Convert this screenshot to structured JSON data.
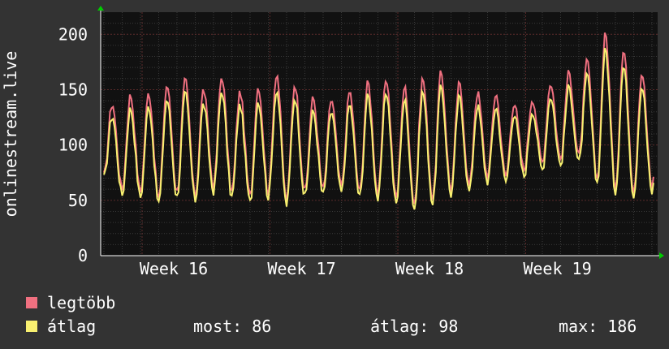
{
  "chart_data": {
    "type": "line",
    "ylabel": "onlinestream.live",
    "ylim": [
      0,
      220
    ],
    "y_ticks": [
      0,
      50,
      100,
      150,
      200
    ],
    "x_ticks": [
      "Week 16",
      "Week 17",
      "Week 18",
      "Week 19"
    ],
    "grid": true,
    "colors": {
      "max": "#f07080",
      "avg": "#f8f070",
      "background": "#333333",
      "plot": "#111111",
      "axis_arrow": "#00cc00"
    },
    "series": [
      {
        "name": "legtöbb",
        "daily_peaks": [
          137,
          145,
          147,
          154,
          158,
          150,
          162,
          148,
          153,
          165,
          155,
          142,
          141,
          148,
          156,
          160,
          152,
          160,
          165,
          155,
          147,
          146,
          138,
          142,
          156,
          165,
          175,
          200,
          185,
          165,
          157,
          163,
          160,
          140,
          142,
          154,
          135
        ],
        "daily_troughs": [
          72,
          60,
          58,
          52,
          58,
          54,
          63,
          58,
          54,
          58,
          50,
          58,
          60,
          62,
          58,
          56,
          52,
          48,
          52,
          60,
          63,
          72,
          72,
          78,
          85,
          88,
          90,
          70,
          63,
          60,
          62,
          60,
          58,
          56,
          62,
          62,
          80
        ]
      },
      {
        "name": "átlag",
        "daily_peaks": [
          126,
          133,
          135,
          141,
          146,
          137,
          149,
          136,
          140,
          150,
          143,
          130,
          130,
          136,
          144,
          148,
          140,
          148,
          152,
          143,
          135,
          134,
          128,
          131,
          144,
          152,
          162,
          186,
          171,
          153,
          145,
          150,
          148,
          129,
          131,
          142,
          125
        ],
        "daily_troughs": [
          70,
          55,
          53,
          48,
          53,
          50,
          58,
          53,
          48,
          53,
          46,
          53,
          55,
          57,
          53,
          51,
          47,
          43,
          47,
          55,
          58,
          67,
          67,
          72,
          78,
          82,
          84,
          66,
          58,
          55,
          57,
          55,
          53,
          51,
          57,
          57,
          76
        ]
      }
    ]
  },
  "legend": {
    "items": [
      {
        "label": "legtöbb",
        "color": "#f07080"
      },
      {
        "label": "átlag",
        "color": "#f8f070"
      }
    ],
    "stats": {
      "now": "most: 86",
      "avg": "átlag: 98",
      "max": "max: 186"
    }
  }
}
